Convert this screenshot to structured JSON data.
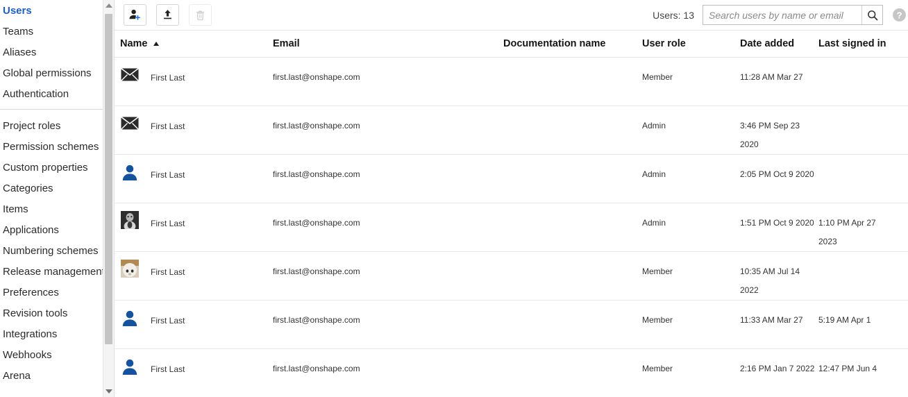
{
  "sidebar": {
    "groups": [
      {
        "items": [
          {
            "label": "Users",
            "active": true
          },
          {
            "label": "Teams",
            "active": false
          },
          {
            "label": "Aliases",
            "active": false
          },
          {
            "label": "Global permissions",
            "active": false
          },
          {
            "label": "Authentication",
            "active": false
          }
        ]
      },
      {
        "items": [
          {
            "label": "Project roles",
            "active": false
          },
          {
            "label": "Permission schemes",
            "active": false
          },
          {
            "label": "Custom properties",
            "active": false
          },
          {
            "label": "Categories",
            "active": false
          },
          {
            "label": "Items",
            "active": false
          },
          {
            "label": "Applications",
            "active": false
          },
          {
            "label": "Numbering schemes",
            "active": false
          },
          {
            "label": "Release management",
            "active": false
          },
          {
            "label": "Preferences",
            "active": false
          },
          {
            "label": "Revision tools",
            "active": false
          },
          {
            "label": "Integrations",
            "active": false
          },
          {
            "label": "Webhooks",
            "active": false
          },
          {
            "label": "Arena",
            "active": false
          }
        ]
      }
    ],
    "scrollbar": {
      "up_icon": "caret-up-icon",
      "down_icon": "caret-down-icon"
    },
    "active_color": "#1d5ec7"
  },
  "toolbar": {
    "add_user_label": "add-user",
    "add_user_icon": "person-add-icon",
    "upload_label": "upload",
    "upload_icon": "upload-icon",
    "delete_label": "delete",
    "delete_icon": "trash-icon",
    "delete_disabled": true,
    "users_count_label": "Users: 13",
    "help_icon": "help-circle-icon"
  },
  "search": {
    "placeholder": "Search users by name or email",
    "value": "",
    "search_icon": "search-icon"
  },
  "table": {
    "columns": [
      {
        "key": "name",
        "label": "Name",
        "sorted": "asc"
      },
      {
        "key": "email",
        "label": "Email"
      },
      {
        "key": "doc",
        "label": "Documentation name"
      },
      {
        "key": "role",
        "label": "User role"
      },
      {
        "key": "date_added",
        "label": "Date added"
      },
      {
        "key": "last_signed_in",
        "label": "Last signed in"
      }
    ],
    "rows": [
      {
        "avatar": "envelope-icon",
        "name": "First Last",
        "email": "first.last@onshape.com",
        "doc": "",
        "role": "Member",
        "date_added": "11:28 AM Mar 27",
        "last_signed_in": ""
      },
      {
        "avatar": "envelope-icon",
        "name": "First Last",
        "email": "first.last@onshape.com",
        "doc": "",
        "role": "Admin",
        "date_added": "3:46 PM Sep 23 2020",
        "last_signed_in": ""
      },
      {
        "avatar": "default-avatar-icon",
        "name": "First Last",
        "email": "first.last@onshape.com",
        "doc": "",
        "role": "Admin",
        "date_added": "2:05 PM Oct 9 2020",
        "last_signed_in": ""
      },
      {
        "avatar": "photo-avatar-dark",
        "name": "First Last",
        "email": "first.last@onshape.com",
        "doc": "",
        "role": "Admin",
        "date_added": "1:51 PM Oct 9 2020",
        "last_signed_in": "1:10 PM Apr 27 2023"
      },
      {
        "avatar": "photo-avatar-light",
        "name": "First Last",
        "email": "first.last@onshape.com",
        "doc": "",
        "role": "Member",
        "date_added": "10:35 AM Jul 14 2022",
        "last_signed_in": ""
      },
      {
        "avatar": "default-avatar-icon",
        "name": "First Last",
        "email": "first.last@onshape.com",
        "doc": "",
        "role": "Member",
        "date_added": "11:33 AM Mar 27",
        "last_signed_in": "5:19 AM Apr 1"
      },
      {
        "avatar": "default-avatar-icon",
        "name": "First Last",
        "email": "first.last@onshape.com",
        "doc": "",
        "role": "Member",
        "date_added": "2:16 PM Jan 7 2022",
        "last_signed_in": "12:47 PM Jun 4"
      }
    ]
  }
}
